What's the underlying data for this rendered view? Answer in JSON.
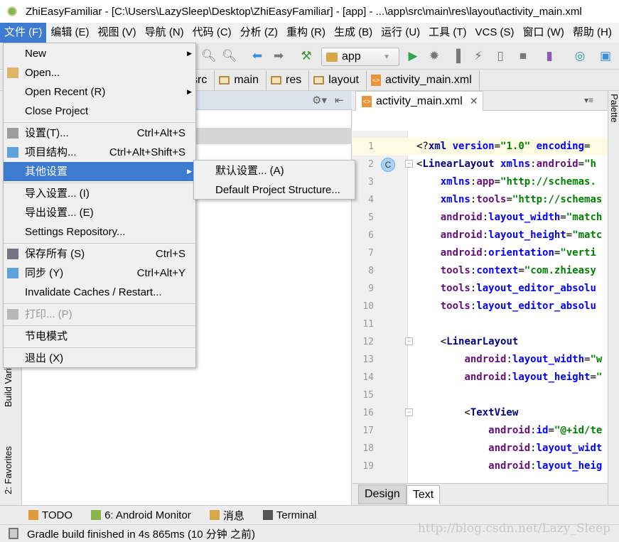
{
  "title": "ZhiEasyFamiliar - [C:\\Users\\LazySleep\\Desktop\\ZhiEasyFamiliar] - [app] - ...\\app\\src\\main\\res\\layout\\activity_main.xml",
  "menubar": [
    "文件 (F)",
    "编辑 (E)",
    "视图 (V)",
    "导航 (N)",
    "代码 (C)",
    "分析 (Z)",
    "重构 (R)",
    "生成 (B)",
    "运行 (U)",
    "工具 (T)",
    "VCS (S)",
    "窗口 (W)",
    "帮助 (H)"
  ],
  "toolbar": {
    "run_config": "app"
  },
  "breadcrumb": [
    "src",
    "main",
    "res",
    "layout",
    "activity_main.xml"
  ],
  "editor": {
    "tab": "activity_main.xml",
    "gutter_badge": "C",
    "lines": [
      [
        [
          "p",
          "<?"
        ],
        [
          "tag",
          "xml "
        ],
        [
          "attr",
          "version"
        ],
        [
          "p",
          "="
        ],
        [
          "val",
          "\"1.0\" "
        ],
        [
          "attr",
          "encoding"
        ],
        [
          "p",
          "="
        ]
      ],
      [
        [
          "p",
          "<"
        ],
        [
          "tag",
          "LinearLayout "
        ],
        [
          "attr",
          "xmlns"
        ],
        [
          "p",
          ":"
        ],
        [
          "ns",
          "android"
        ],
        [
          "p",
          "="
        ],
        [
          "val",
          "\"h"
        ]
      ],
      [
        [
          "p",
          "    "
        ],
        [
          "attr",
          "xmlns"
        ],
        [
          "p",
          ":"
        ],
        [
          "ns",
          "app"
        ],
        [
          "p",
          "="
        ],
        [
          "val",
          "\"http://schemas."
        ]
      ],
      [
        [
          "p",
          "    "
        ],
        [
          "attr",
          "xmlns"
        ],
        [
          "p",
          ":"
        ],
        [
          "ns",
          "tools"
        ],
        [
          "p",
          "="
        ],
        [
          "val",
          "\"http://schemas"
        ]
      ],
      [
        [
          "p",
          "    "
        ],
        [
          "ns",
          "android"
        ],
        [
          "p",
          ":"
        ],
        [
          "attr",
          "layout_width"
        ],
        [
          "p",
          "="
        ],
        [
          "val",
          "\"match"
        ]
      ],
      [
        [
          "p",
          "    "
        ],
        [
          "ns",
          "android"
        ],
        [
          "p",
          ":"
        ],
        [
          "attr",
          "layout_height"
        ],
        [
          "p",
          "="
        ],
        [
          "val",
          "\"matc"
        ]
      ],
      [
        [
          "p",
          "    "
        ],
        [
          "ns",
          "android"
        ],
        [
          "p",
          ":"
        ],
        [
          "attr",
          "orientation"
        ],
        [
          "p",
          "="
        ],
        [
          "val",
          "\"verti"
        ]
      ],
      [
        [
          "p",
          "    "
        ],
        [
          "ns",
          "tools"
        ],
        [
          "p",
          ":"
        ],
        [
          "attr",
          "context"
        ],
        [
          "p",
          "="
        ],
        [
          "val",
          "\"com.zhieasy"
        ]
      ],
      [
        [
          "p",
          "    "
        ],
        [
          "ns",
          "tools"
        ],
        [
          "p",
          ":"
        ],
        [
          "attr",
          "layout_editor_absolu"
        ]
      ],
      [
        [
          "p",
          "    "
        ],
        [
          "ns",
          "tools"
        ],
        [
          "p",
          ":"
        ],
        [
          "attr",
          "layout_editor_absolu"
        ]
      ],
      [],
      [
        [
          "p",
          "    <"
        ],
        [
          "tag",
          "LinearLayout"
        ]
      ],
      [
        [
          "p",
          "        "
        ],
        [
          "ns",
          "android"
        ],
        [
          "p",
          ":"
        ],
        [
          "attr",
          "layout_width"
        ],
        [
          "p",
          "="
        ],
        [
          "val",
          "\"w"
        ]
      ],
      [
        [
          "p",
          "        "
        ],
        [
          "ns",
          "android"
        ],
        [
          "p",
          ":"
        ],
        [
          "attr",
          "layout_height"
        ],
        [
          "p",
          "="
        ],
        [
          "val",
          "\""
        ]
      ],
      [],
      [
        [
          "p",
          "        <"
        ],
        [
          "tag",
          "TextView"
        ]
      ],
      [
        [
          "p",
          "            "
        ],
        [
          "ns",
          "android"
        ],
        [
          "p",
          ":"
        ],
        [
          "attr",
          "id"
        ],
        [
          "p",
          "="
        ],
        [
          "val",
          "\"@+id/te"
        ]
      ],
      [
        [
          "p",
          "            "
        ],
        [
          "ns",
          "android"
        ],
        [
          "p",
          ":"
        ],
        [
          "attr",
          "layout_widt"
        ]
      ],
      [
        [
          "p",
          "            "
        ],
        [
          "ns",
          "android"
        ],
        [
          "p",
          ":"
        ],
        [
          "attr",
          "layout_heig"
        ]
      ]
    ],
    "bottom_tabs": [
      "Design",
      "Text"
    ]
  },
  "side_tabs": {
    "left": [
      "Build Variants",
      "2: Favorites"
    ],
    "right": "Palette"
  },
  "file_menu": [
    {
      "label": "New",
      "submenu": true
    },
    {
      "label": "Open...",
      "icon": "folder-icon"
    },
    {
      "label": "Open Recent (R)",
      "submenu": true
    },
    {
      "label": "Close Project"
    },
    {
      "sep": true
    },
    {
      "label": "设置(T)...",
      "shortcut": "Ctrl+Alt+S",
      "icon": "settings-icon"
    },
    {
      "label": "项目结构...",
      "shortcut": "Ctrl+Alt+Shift+S",
      "icon": "project-structure-icon"
    },
    {
      "label": "其他设置",
      "submenu": true,
      "highlighted": true
    },
    {
      "sep": true
    },
    {
      "label": "导入设置... (I)"
    },
    {
      "label": "导出设置... (E)"
    },
    {
      "label": "Settings Repository..."
    },
    {
      "sep": true
    },
    {
      "label": "保存所有 (S)",
      "shortcut": "Ctrl+S",
      "icon": "save-icon"
    },
    {
      "label": "同步 (Y)",
      "shortcut": "Ctrl+Alt+Y",
      "icon": "sync-icon"
    },
    {
      "label": "Invalidate Caches / Restart..."
    },
    {
      "sep": true
    },
    {
      "label": "打印... (P)",
      "disabled": true,
      "icon": "print-icon"
    },
    {
      "sep": true
    },
    {
      "label": "节电模式"
    },
    {
      "sep": true
    },
    {
      "label": "退出 (X)"
    }
  ],
  "submenu": [
    "默认设置... (A)",
    "Default Project Structure..."
  ],
  "tool_windows": [
    "TODO",
    "6: Android Monitor",
    "消息",
    "Terminal"
  ],
  "status": "Gradle build finished in 4s 865ms (10 分钟 之前)",
  "watermark": "http://blog.csdn.net/Lazy_Sleep",
  "colors": {
    "menu_highlight": "#3d7bd0",
    "run_green": "#2ea44f"
  }
}
